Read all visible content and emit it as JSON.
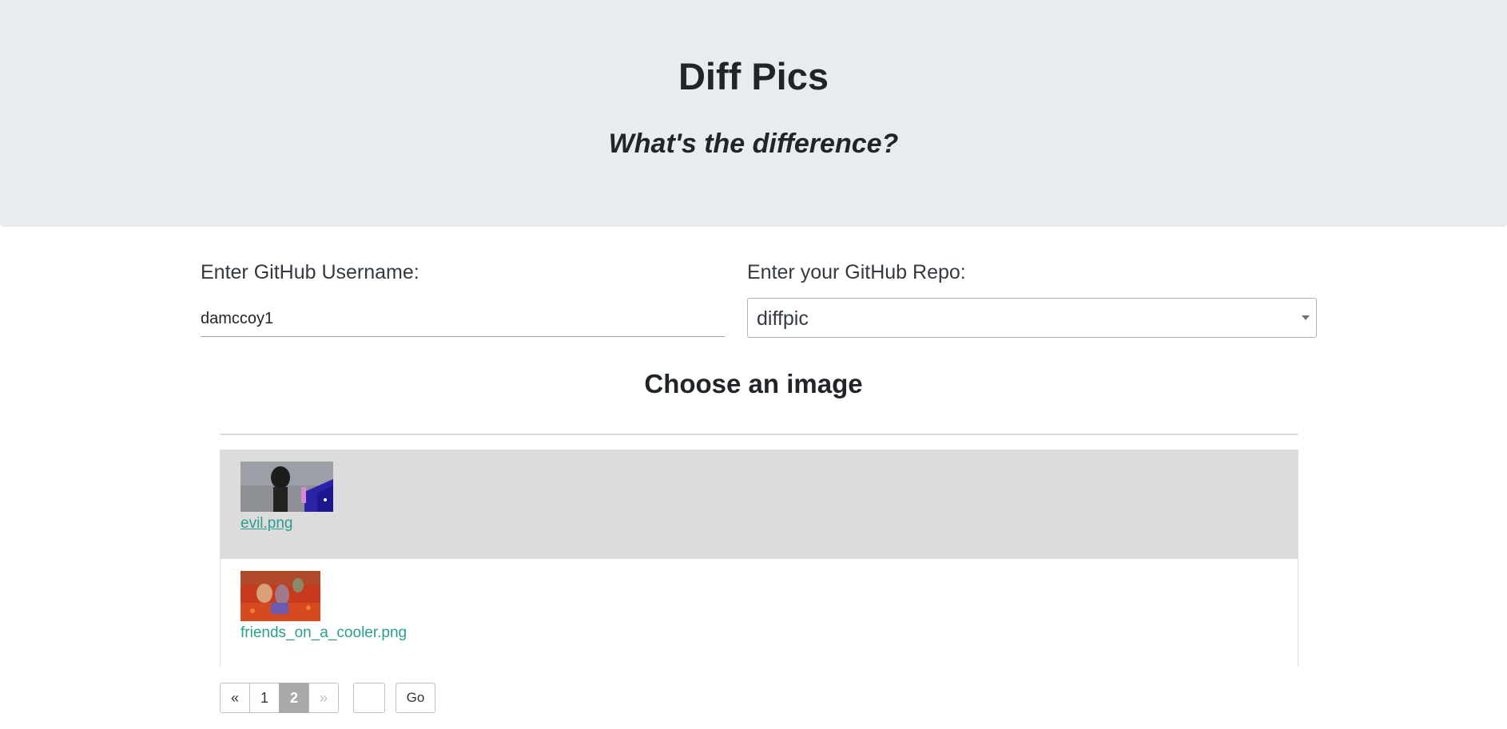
{
  "header": {
    "title": "Diff Pics",
    "subtitle": "What's the difference?"
  },
  "form": {
    "username_label": "Enter GitHub Username:",
    "username_value": "damccoy1",
    "repo_label": "Enter your GitHub Repo:",
    "repo_selected": "diffpic"
  },
  "images": {
    "heading": "Choose an image",
    "items": [
      {
        "filename": "evil.png",
        "thumbnail_icon": "image-thumbnail"
      },
      {
        "filename": "friends_on_a_cooler.png",
        "thumbnail_icon": "image-thumbnail"
      }
    ]
  },
  "pagination": {
    "prev": "«",
    "pages": [
      "1",
      "2"
    ],
    "current_page": "2",
    "next": "»",
    "go_label": "Go"
  },
  "colors": {
    "header_background": "#e9ecef",
    "link": "#2a9d8f",
    "active_row": "#dcdcdc",
    "current_page": "#a9a9a9"
  }
}
